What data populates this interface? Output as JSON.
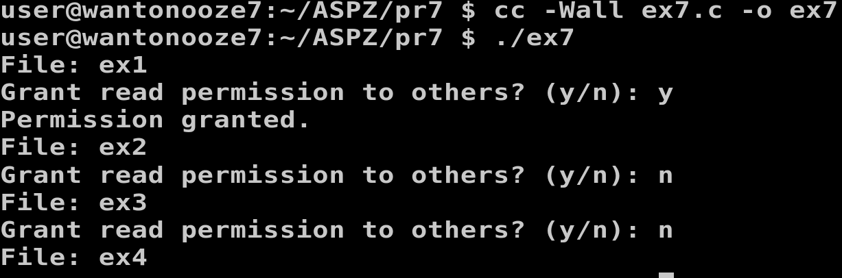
{
  "terminal": {
    "lines": [
      "user@wantonooze7:~/ASPZ/pr7 $ cc -Wall ex7.c -o ex7",
      "user@wantonooze7:~/ASPZ/pr7 $ ./ex7",
      "File: ex1",
      "Grant read permission to others? (y/n): y",
      "Permission granted.",
      "File: ex2",
      "Grant read permission to others? (y/n): n",
      "File: ex3",
      "Grant read permission to others? (y/n): n",
      "File: ex4"
    ],
    "text_color": "#c8c8c8",
    "background_color": "#000000"
  }
}
